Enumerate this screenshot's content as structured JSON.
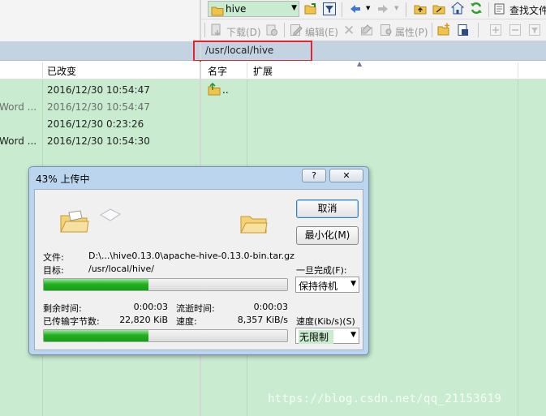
{
  "toolbar": {
    "dir_combo_value": "hive",
    "search_label": "查找文件",
    "download_label": "下载(D)",
    "edit_label": "编辑(E)",
    "properties_label": "属性(P)"
  },
  "remote_path": "/usr/local/hive",
  "left_pane": {
    "header_modified": "已改变",
    "files": [
      {
        "type": "",
        "modified": "2016/12/30   10:54:47"
      },
      {
        "type": "Word ...",
        "modified": "2016/12/30   10:54:47"
      },
      {
        "type": "",
        "modified": "2016/12/30   0:23:26"
      },
      {
        "type": "Word ...",
        "modified": "2016/12/30   10:54:30"
      }
    ]
  },
  "right_pane": {
    "header_name": "名字",
    "header_ext": "扩展",
    "parent_dir": ".."
  },
  "dialog": {
    "title": "43% 上传中",
    "help_glyph": "?",
    "close_glyph": "✕",
    "cancel_label": "取消",
    "minimize_label": "最小化(M)",
    "file_label": "文件:",
    "file_value": "D:\\...\\hive0.13.0\\apache-hive-0.13.0-bin.tar.gz",
    "target_label": "目标:",
    "target_value": "/usr/local/hive/",
    "on_complete_label": "一旦完成(F):",
    "on_complete_value": "保持待机",
    "file_progress_pct": 43,
    "remaining_label": "剩余时间:",
    "remaining_value": "0:00:03",
    "elapsed_label": "流逝时间:",
    "elapsed_value": "0:00:03",
    "transferred_label": "已传输字节数:",
    "transferred_value": "22,820 KiB",
    "speed_label": "速度:",
    "speed_value": "8,357 KiB/s",
    "speed_limit_label": "速度(Kib/s)(S)",
    "speed_limit_value": "无限制",
    "total_progress_pct": 43
  },
  "watermark": "https://blog.csdn.net/qq_21153619",
  "colors": {
    "list_bg": "#c9ecd0",
    "path_bar": "#c4d3e2",
    "progress_green": "#22b022",
    "highlight_red": "#e8232f",
    "dialog_frame": "#bcd5ee"
  }
}
